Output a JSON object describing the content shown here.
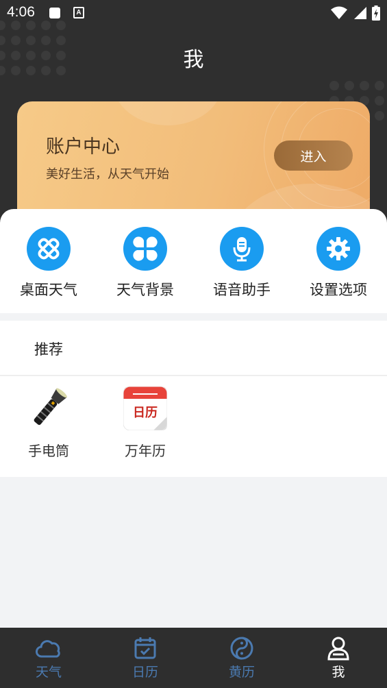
{
  "status_bar": {
    "time": "4:06",
    "notif_letter": "A"
  },
  "header": {
    "title": "我"
  },
  "account_card": {
    "title": "账户中心",
    "subtitle": "美好生活，从天气开始",
    "enter_label": "进入"
  },
  "tools": [
    {
      "label": "桌面天气",
      "icon": "widget-icon"
    },
    {
      "label": "天气背景",
      "icon": "clover-icon"
    },
    {
      "label": "语音助手",
      "icon": "microphone-icon"
    },
    {
      "label": "设置选项",
      "icon": "gear-icon"
    }
  ],
  "recommend": {
    "title": "推荐",
    "apps": [
      {
        "label": "手电筒",
        "icon": "flashlight-icon"
      },
      {
        "label": "万年历",
        "icon": "calendar-app-icon",
        "icon_text": "日历"
      }
    ]
  },
  "tabbar": {
    "items": [
      {
        "label": "天气",
        "icon": "cloud-icon",
        "active": false
      },
      {
        "label": "日历",
        "icon": "calendar-icon",
        "active": false
      },
      {
        "label": "黄历",
        "icon": "yinyang-icon",
        "active": false
      },
      {
        "label": "我",
        "icon": "person-icon",
        "active": true
      }
    ]
  },
  "colors": {
    "accent": "#1a9cf0",
    "tab_inactive": "#4b7ab0",
    "tab_active": "#ffffff",
    "card_gold": "#f2bd7a",
    "header_dark": "#2f2f2f"
  }
}
